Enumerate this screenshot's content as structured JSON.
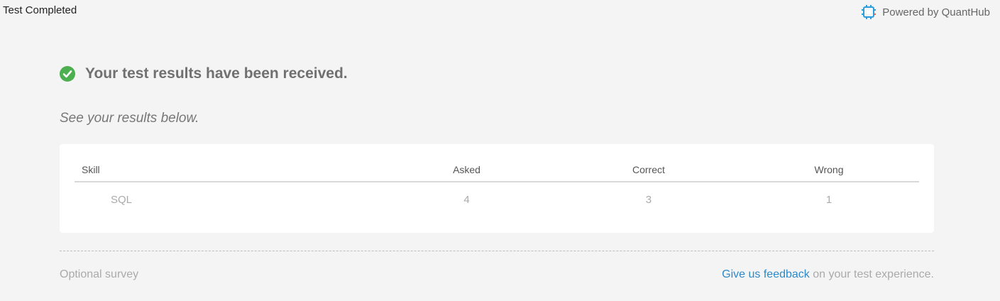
{
  "header": {
    "title": "Test Completed",
    "brand_text": "Powered by QuantHub",
    "brand_icon": "quanthub-chip-icon"
  },
  "main": {
    "success_message": "Your test results have been received.",
    "success_icon": "check-circle-icon",
    "subtitle": "See your results below.",
    "results_table": {
      "columns": [
        "Skill",
        "Asked",
        "Correct",
        "Wrong"
      ],
      "rows": [
        {
          "skill": "SQL",
          "asked": "4",
          "correct": "3",
          "wrong": "1"
        }
      ]
    }
  },
  "footer": {
    "survey_label": "Optional survey",
    "feedback_link": "Give us feedback",
    "feedback_suffix": " on your test experience."
  },
  "colors": {
    "background": "#f4f4f4",
    "success_green": "#4caf50",
    "link_blue": "#2d8ac7",
    "brand_blue": "#2d9cdb"
  }
}
